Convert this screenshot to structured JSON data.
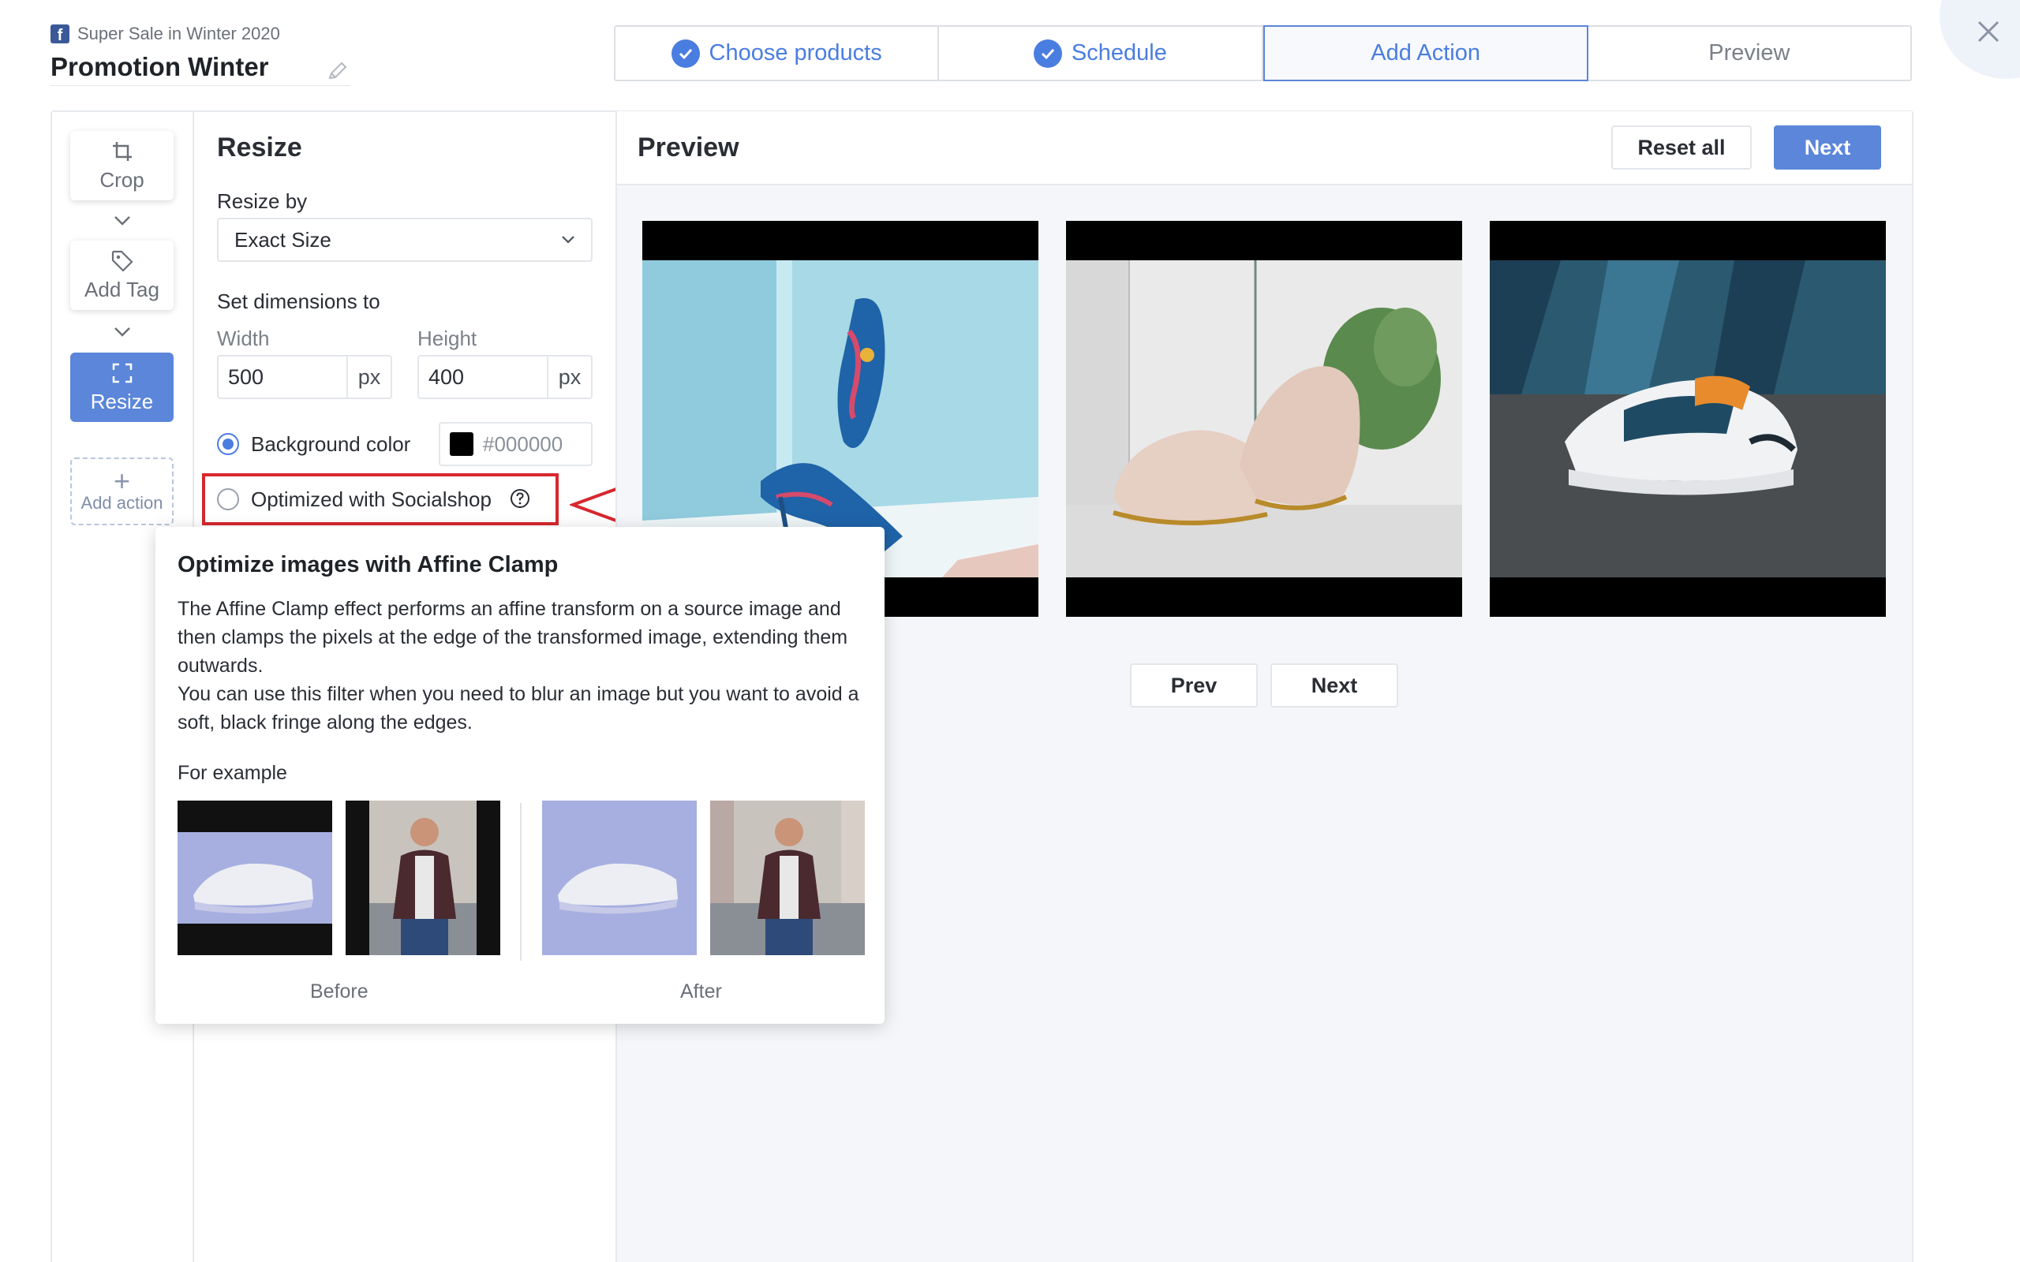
{
  "header": {
    "campaign_name": "Super Sale in Winter 2020",
    "title": "Promotion Winter"
  },
  "stepper": [
    {
      "label": "Choose products",
      "state": "done"
    },
    {
      "label": "Schedule",
      "state": "done"
    },
    {
      "label": "Add Action",
      "state": "active"
    },
    {
      "label": "Preview",
      "state": "pending"
    }
  ],
  "actions": {
    "crop": "Crop",
    "add_tag": "Add Tag",
    "resize": "Resize",
    "add_action": "Add action"
  },
  "resize_panel": {
    "title": "Resize",
    "resize_by_label": "Resize by",
    "resize_by_value": "Exact Size",
    "dimensions_label": "Set dimensions to",
    "width_label": "Width",
    "width_value": "500",
    "width_unit": "px",
    "height_label": "Height",
    "height_value": "400",
    "height_unit": "px",
    "bg_color_label": "Background color",
    "bg_color_value": "#000000",
    "optimized_label": "Optimized with Socialshop"
  },
  "preview": {
    "title": "Preview",
    "reset_label": "Reset all",
    "next_label": "Next",
    "prev_page_label": "Prev",
    "next_page_label": "Next"
  },
  "popover": {
    "title": "Optimize images with Affine Clamp",
    "body_line1": "The Affine Clamp effect performs an affine transform on a source image and then clamps the pixels at the edge of the transformed image, extending them outwards.",
    "body_line2": "You can use this filter when you need to blur an image but you want to avoid a soft, black fringe along the edges.",
    "example_label": "For example",
    "before_label": "Before",
    "after_label": "After"
  },
  "colors": {
    "accent": "#5b86d9",
    "highlight": "#d6282e"
  }
}
